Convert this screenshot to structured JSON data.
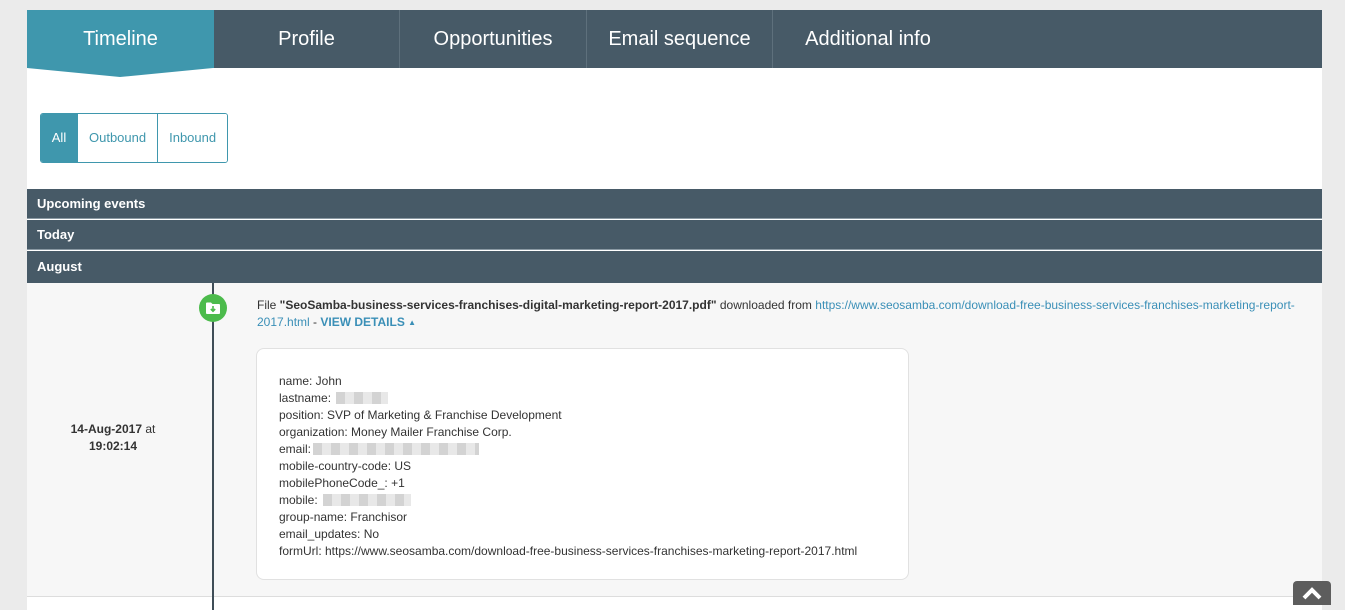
{
  "tabs": [
    "Timeline",
    "Profile",
    "Opportunities",
    "Email sequence",
    "Additional info"
  ],
  "filters": [
    "All",
    "Outbound",
    "Inbound"
  ],
  "sections": [
    "Upcoming events",
    "Today",
    "August"
  ],
  "event": {
    "date": "14-Aug-2017",
    "at": "at",
    "time": "19:02:14",
    "prefix": "File ",
    "filename": "\"SeoSamba-business-services-franchises-digital-marketing-report-2017.pdf\"",
    "mid": " downloaded from ",
    "url": "https://www.seosamba.com/download-free-business-services-franchises-marketing-report-2017.html",
    "sep": " - ",
    "view_details": "VIEW DETAILS"
  },
  "details": {
    "name": "name: John",
    "lastname": "lastname:",
    "position": "position: SVP of Marketing & Franchise Development",
    "organization": "organization: Money Mailer Franchise Corp.",
    "email": "email:",
    "mobile_country_code": "mobile-country-code: US",
    "mobile_phone_code": "mobilePhoneCode_: +1",
    "mobile": "mobile:",
    "group_name": "group-name: Franchisor",
    "email_updates": "email_updates: No",
    "form_url": "formUrl: https://www.seosamba.com/download-free-business-services-franchises-marketing-report-2017.html"
  },
  "icons": {
    "event_icon": "download-folder-icon",
    "scroll_top": "chevron-up-icon"
  },
  "colors": {
    "tab_bar": "#475a67",
    "active_accent": "#3f97ad",
    "event_dot": "#4cbb4c",
    "link": "#3a8fb7"
  }
}
